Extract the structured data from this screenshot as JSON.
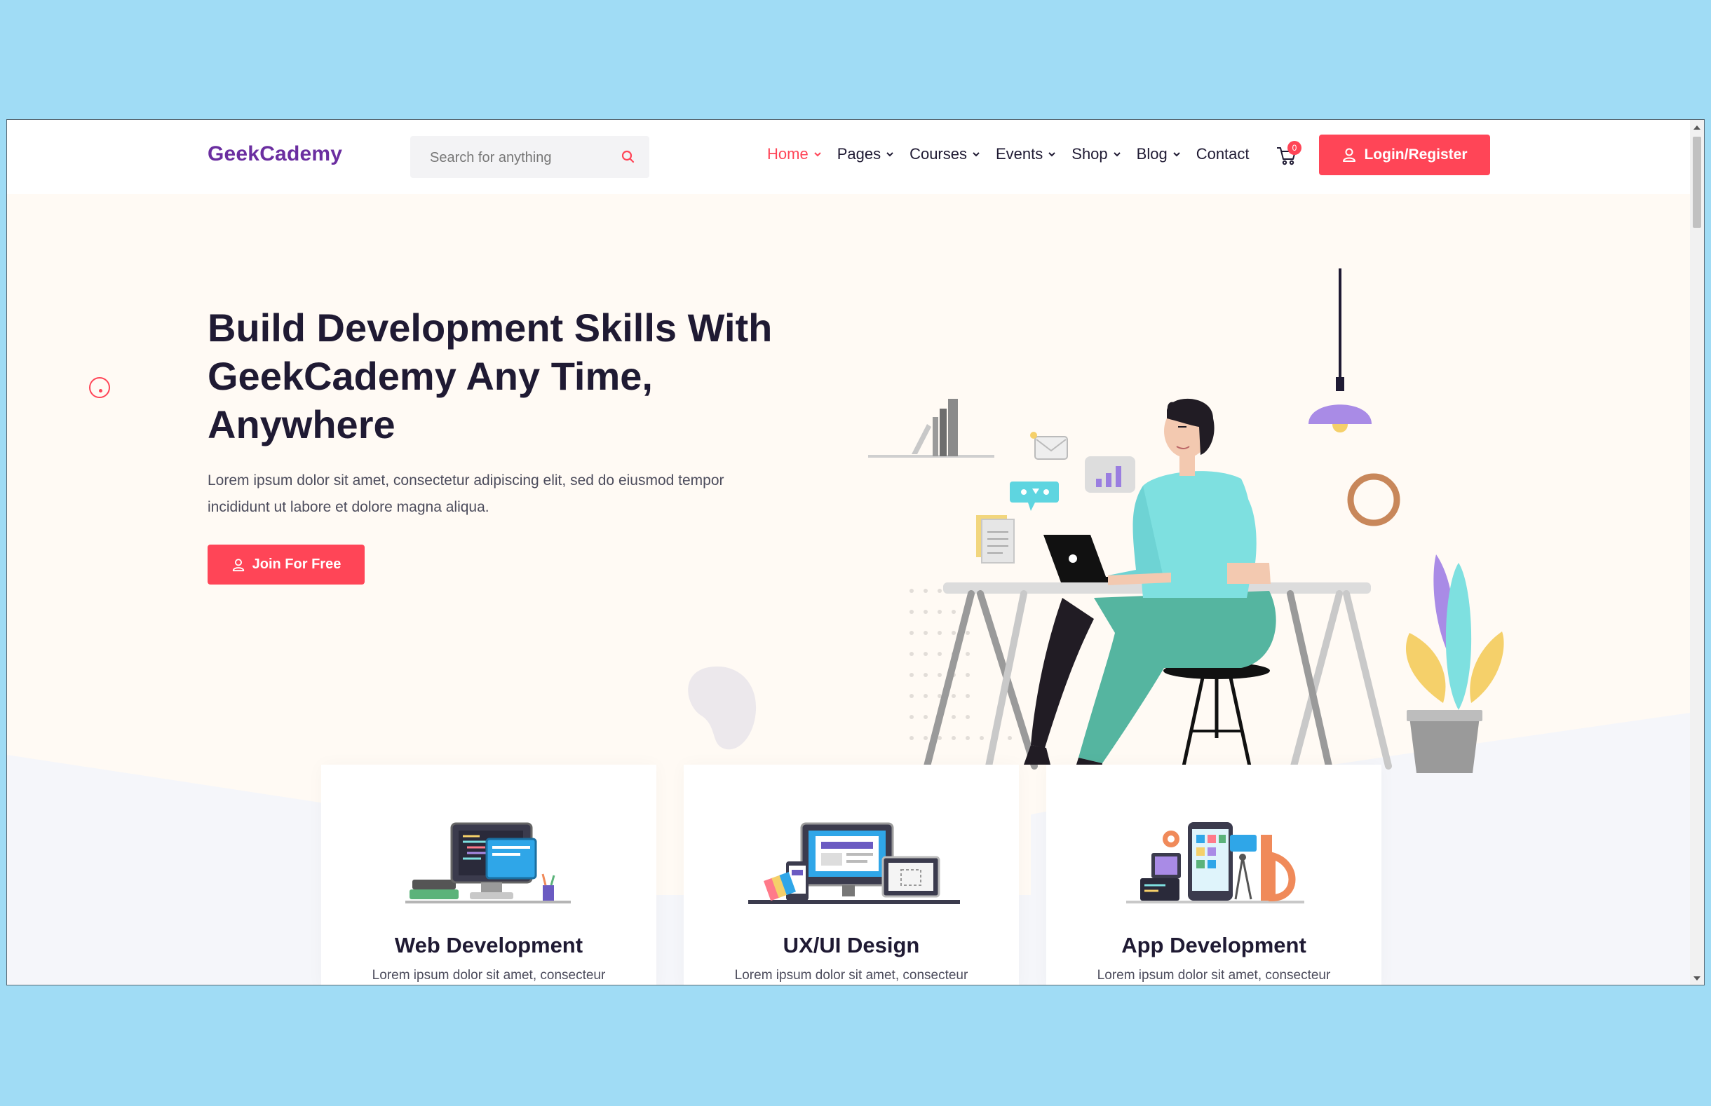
{
  "header": {
    "logo": "GeekCademy",
    "search_placeholder": "Search for anything",
    "nav": [
      {
        "label": "Home",
        "dropdown": true,
        "active": true
      },
      {
        "label": "Pages",
        "dropdown": true
      },
      {
        "label": "Courses",
        "dropdown": true
      },
      {
        "label": "Events",
        "dropdown": true
      },
      {
        "label": "Shop",
        "dropdown": true
      },
      {
        "label": "Blog",
        "dropdown": true
      },
      {
        "label": "Contact",
        "dropdown": false
      }
    ],
    "cart_count": "0",
    "login_label": "Login/Register"
  },
  "hero": {
    "title_line1": "Build Development Skills With",
    "title_line2": "GeekCademy Any Time,",
    "title_line3": "Anywhere",
    "description_line1": "Lorem ipsum dolor sit amet, consectetur adipiscing elit, sed do eiusmod tempor",
    "description_line2": "incididunt ut labore et dolore magna aliqua.",
    "cta_label": "Join For Free"
  },
  "cards": [
    {
      "title": "Web Development",
      "desc": "Lorem ipsum dolor sit amet, consecteur",
      "icon": "web-development-icon"
    },
    {
      "title": "UX/UI Design",
      "desc": "Lorem ipsum dolor sit amet, consecteur",
      "icon": "ux-ui-design-icon"
    },
    {
      "title": "App Development",
      "desc": "Lorem ipsum dolor sit amet, consecteur",
      "icon": "app-development-icon"
    }
  ],
  "colors": {
    "accent": "#ff4557",
    "logo": "#6b2ea0",
    "heading": "#1f1a33",
    "hero_bg": "#fffaf4",
    "page_bg": "#a0dcf5"
  }
}
